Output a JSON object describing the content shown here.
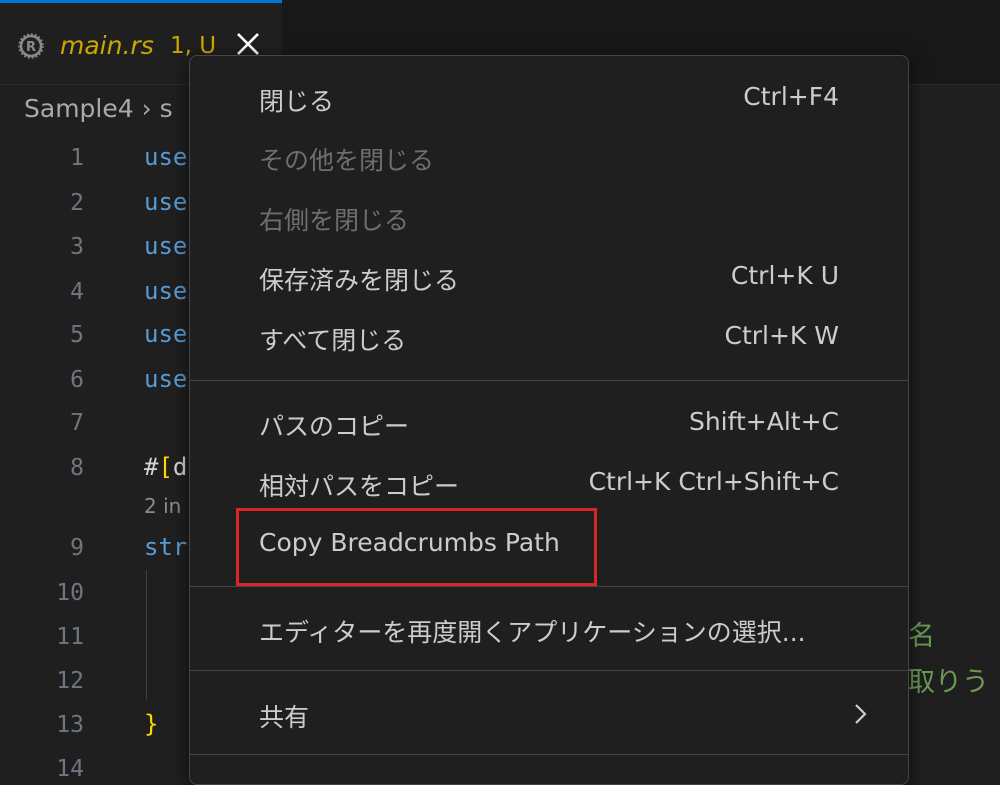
{
  "tab": {
    "title": "main.rs",
    "badge": "1, U",
    "icon": "rust-icon",
    "close_icon": "close-icon"
  },
  "breadcrumb": {
    "items": [
      "Sample4",
      "s"
    ]
  },
  "editor": {
    "line_numbers": [
      "1",
      "2",
      "3",
      "4",
      "5",
      "6",
      "7",
      "8",
      "9",
      "10",
      "11",
      "12",
      "13",
      "14"
    ],
    "lines": {
      "l1": "use",
      "l2": "use",
      "l3": "use",
      "l4": "use",
      "l5": "use",
      "l6": "use",
      "l8_hash": "#",
      "l8_bracket": "[",
      "l8_rest": "d",
      "hint": "2 in",
      "l9": "str",
      "l13": "}"
    },
    "right_text": [
      "名",
      "取りう"
    ]
  },
  "menu": {
    "items": [
      {
        "label": "閉じる",
        "shortcut": "Ctrl+F4",
        "enabled": true
      },
      {
        "label": "その他を閉じる",
        "shortcut": "",
        "enabled": false
      },
      {
        "label": "右側を閉じる",
        "shortcut": "",
        "enabled": false
      },
      {
        "label": "保存済みを閉じる",
        "shortcut": "Ctrl+K U",
        "enabled": true
      },
      {
        "label": "すべて閉じる",
        "shortcut": "Ctrl+K W",
        "enabled": true
      },
      {
        "label": "パスのコピー",
        "shortcut": "Shift+Alt+C",
        "enabled": true
      },
      {
        "label": "相対パスをコピー",
        "shortcut": "Ctrl+K Ctrl+Shift+C",
        "enabled": true
      },
      {
        "label": "Copy Breadcrumbs Path",
        "shortcut": "",
        "enabled": true
      },
      {
        "label": "エディターを再度開くアプリケーションの選択...",
        "shortcut": "",
        "enabled": true
      },
      {
        "label": "共有",
        "shortcut": "",
        "enabled": true
      }
    ]
  },
  "colors": {
    "background": "#1f1f1f",
    "accent": "#0078d4",
    "modified": "#cca700",
    "highlight": "#d9262b"
  }
}
